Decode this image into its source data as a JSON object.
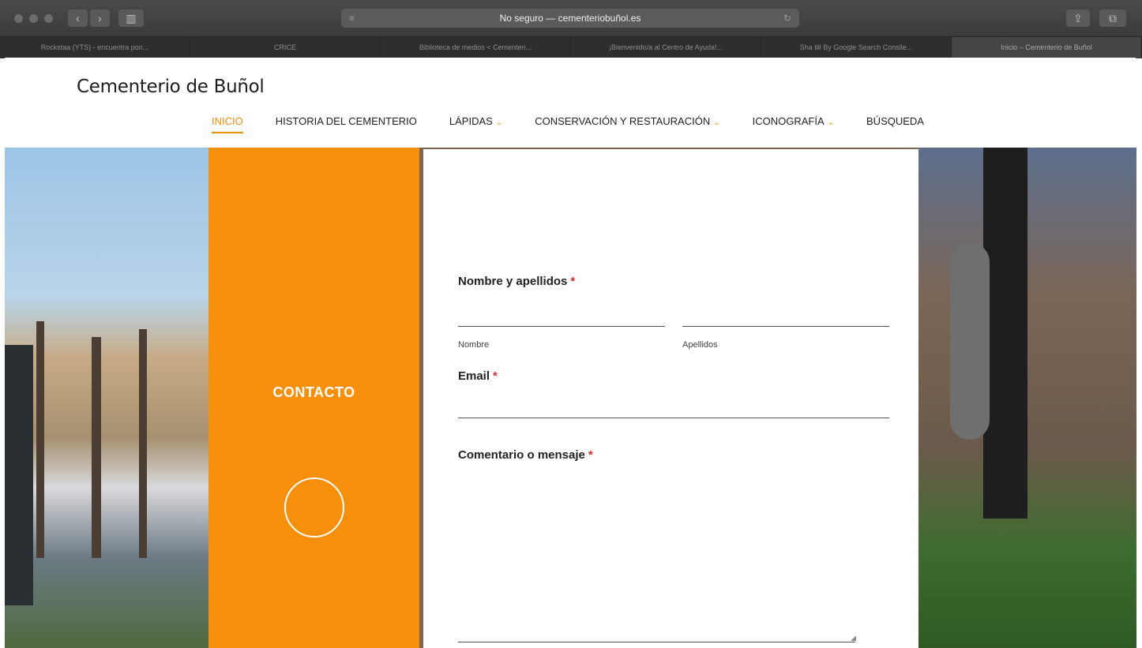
{
  "browser": {
    "back_icon": "chevron-left-icon",
    "forward_icon": "chevron-right-icon",
    "sidebar_icon": "sidebar-icon",
    "address": "No seguro — cementeriobuñol.es",
    "tabs": [
      "Rockstaa (YTS) - encuentra pon...",
      "CRICE",
      "Biblioteca de medios < Cementeri...",
      "¡Bienvenido/a al Centro de Ayuda!...",
      "Sha till By Google Search Conslle...",
      "Inicio – Cementerio de Buñol"
    ]
  },
  "site": {
    "title": "Cementerio de Buñol",
    "menu": [
      {
        "label": "INICIO",
        "active": true,
        "dropdown": false
      },
      {
        "label": "HISTORIA DEL CEMENTERIO",
        "active": false,
        "dropdown": false
      },
      {
        "label": "LÁPIDAS",
        "active": false,
        "dropdown": true
      },
      {
        "label": "CONSERVACIÓN Y RESTAURACIÓN",
        "active": false,
        "dropdown": true
      },
      {
        "label": "ICONOGRAFÍA",
        "active": false,
        "dropdown": true
      },
      {
        "label": "BÚSQUEDA",
        "active": false,
        "dropdown": false
      }
    ],
    "accent_color": "#f68f0c"
  },
  "contact_panel": {
    "title": "CONTACTO"
  },
  "form": {
    "name_label": "Nombre y apellidos",
    "required_marker": "*",
    "first_name_value": "",
    "first_name_sublabel": "Nombre",
    "last_name_value": "",
    "last_name_sublabel": "Apellidos",
    "email_label": "Email",
    "email_value": "",
    "message_label": "Comentario o mensaje",
    "message_value": ""
  }
}
